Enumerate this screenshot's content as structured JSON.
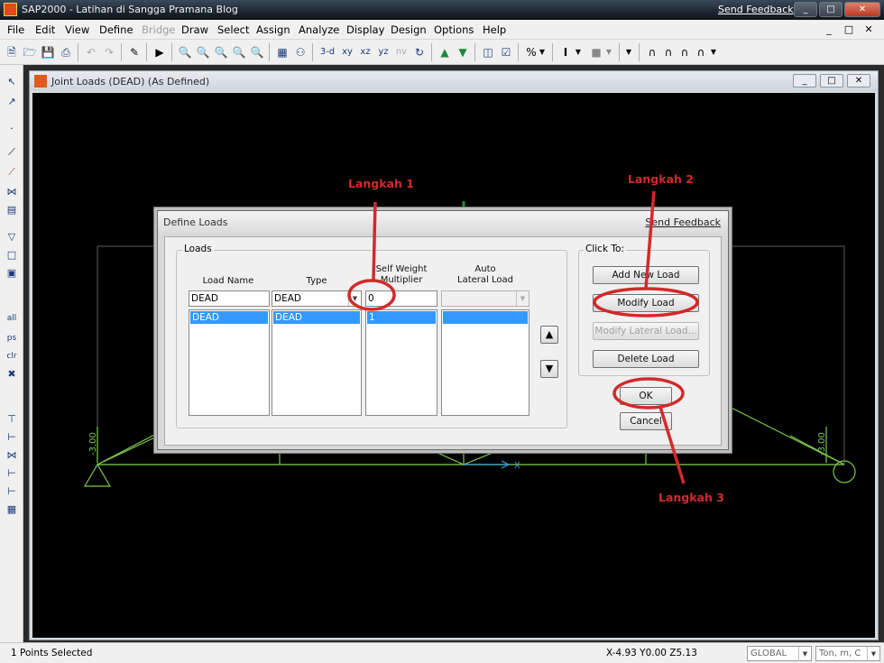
{
  "app": {
    "window_title": "SAP2000 - Latihan di Sangga Pramana Blog",
    "send_feedback": "Send Feedback",
    "window_buttons": [
      "_",
      "□",
      "✕"
    ]
  },
  "menu": {
    "items": [
      {
        "label": "File",
        "enabled": true
      },
      {
        "label": "Edit",
        "enabled": true
      },
      {
        "label": "View",
        "enabled": true
      },
      {
        "label": "Define",
        "enabled": true
      },
      {
        "label": "Bridge",
        "enabled": false
      },
      {
        "label": "Draw",
        "enabled": true
      },
      {
        "label": "Select",
        "enabled": true
      },
      {
        "label": "Assign",
        "enabled": true
      },
      {
        "label": "Analyze",
        "enabled": true
      },
      {
        "label": "Display",
        "enabled": true
      },
      {
        "label": "Design",
        "enabled": true
      },
      {
        "label": "Options",
        "enabled": true
      },
      {
        "label": "Help",
        "enabled": true
      }
    ],
    "mdi_buttons": [
      "_",
      "□",
      "✕"
    ]
  },
  "toolbar": {
    "view_buttons": [
      "3-d",
      "xy",
      "xz",
      "yz",
      "nv"
    ]
  },
  "inner_window": {
    "title": "Joint Loads (DEAD) (As Defined)"
  },
  "canvas": {
    "left_load_label": "-3.00",
    "right_load_label": "-3.00",
    "axis_label": "X"
  },
  "dialog": {
    "title": "Define Loads",
    "send_feedback": "Send Feedback",
    "loads_group": {
      "label": "Loads",
      "headers": {
        "load_name": "Load Name",
        "type": "Type",
        "self_weight_1": "Self Weight",
        "self_weight_2": "Multiplier",
        "auto_1": "Auto",
        "auto_2": "Lateral Load"
      },
      "input": {
        "load_name": "DEAD",
        "type": "DEAD",
        "multiplier": "0",
        "auto_lateral": ""
      },
      "rows": [
        {
          "load_name": "DEAD",
          "type": "DEAD",
          "multiplier": "1",
          "auto_lateral": ""
        }
      ]
    },
    "click_to_group": {
      "label": "Click To:",
      "buttons": {
        "add_new_load": "Add New Load",
        "modify_load": "Modify Load",
        "modify_lateral_load": "Modify Lateral Load...",
        "delete_load": "Delete Load"
      }
    },
    "ok": "OK",
    "cancel": "Cancel"
  },
  "annotations": {
    "step1": "Langkah 1",
    "step2": "Langkah 2",
    "step3": "Langkah 3",
    "color": "#d22a2a"
  },
  "status": {
    "left": "1 Points Selected",
    "coords": "X-4.93  Y0.00  Z5.13",
    "coord_system": "GLOBAL",
    "units": "Ton, m, C"
  },
  "colors": {
    "structure": "#7cc84a",
    "selection": "#3399ff",
    "annotation": "#d22a2a"
  }
}
